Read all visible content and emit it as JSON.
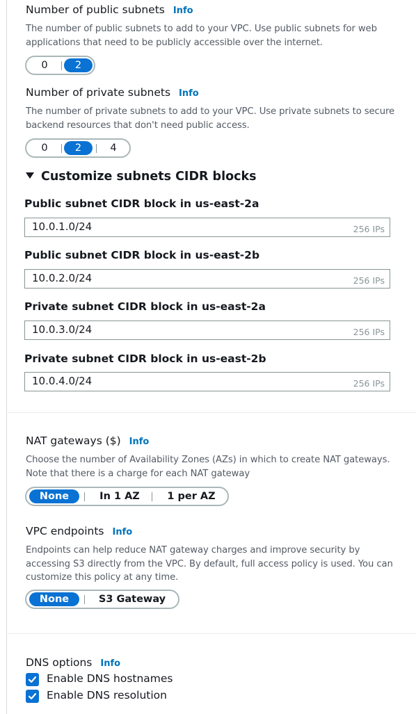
{
  "public_subnets": {
    "label": "Number of public subnets",
    "info": "Info",
    "desc_line1": "The number of public subnets to add to your VPC. Use public subnets for web",
    "desc_line2": "applications that need to be publicly accessible over the internet.",
    "options": [
      "0",
      "2"
    ],
    "selected": "2"
  },
  "private_subnets": {
    "label": "Number of private subnets",
    "info": "Info",
    "desc_line1": "The number of private subnets to add to your VPC. Use private subnets to secure",
    "desc_line2": "backend resources that don't need public access.",
    "options": [
      "0",
      "2",
      "4"
    ],
    "selected": "2"
  },
  "customize": {
    "title": "Customize subnets CIDR blocks",
    "expanded": true,
    "blocks": [
      {
        "label": "Public subnet CIDR block in us-east-2a",
        "value": "10.0.1.0/24",
        "ips": "256 IPs"
      },
      {
        "label": "Public subnet CIDR block in us-east-2b",
        "value": "10.0.2.0/24",
        "ips": "256 IPs"
      },
      {
        "label": "Private subnet CIDR block in us-east-2a",
        "value": "10.0.3.0/24",
        "ips": "256 IPs"
      },
      {
        "label": "Private subnet CIDR block in us-east-2b",
        "value": "10.0.4.0/24",
        "ips": "256 IPs"
      }
    ]
  },
  "nat": {
    "label": "NAT gateways ($)",
    "info": "Info",
    "desc_line1": "Choose the number of Availability Zones (AZs) in which to create NAT gateways.",
    "desc_line2": "Note that there is a charge for each NAT gateway",
    "options": [
      "None",
      "In 1 AZ",
      "1 per AZ"
    ],
    "selected": "None"
  },
  "endpoints": {
    "label": "VPC endpoints",
    "info": "Info",
    "desc_line1": "Endpoints can help reduce NAT gateway charges and improve security by",
    "desc_line2": "accessing S3 directly from the VPC. By default, full access policy is used. You can",
    "desc_line3": "customize this policy at any time.",
    "options": [
      "None",
      "S3 Gateway"
    ],
    "selected": "None"
  },
  "dns": {
    "label": "DNS options",
    "info": "Info",
    "hostnames_label": "Enable DNS hostnames",
    "hostnames_checked": true,
    "resolution_label": "Enable DNS resolution",
    "resolution_checked": true
  },
  "colors": {
    "accent": "#0972d3",
    "info_link": "#0073bb",
    "text": "#16191f",
    "muted": "#545b64"
  }
}
